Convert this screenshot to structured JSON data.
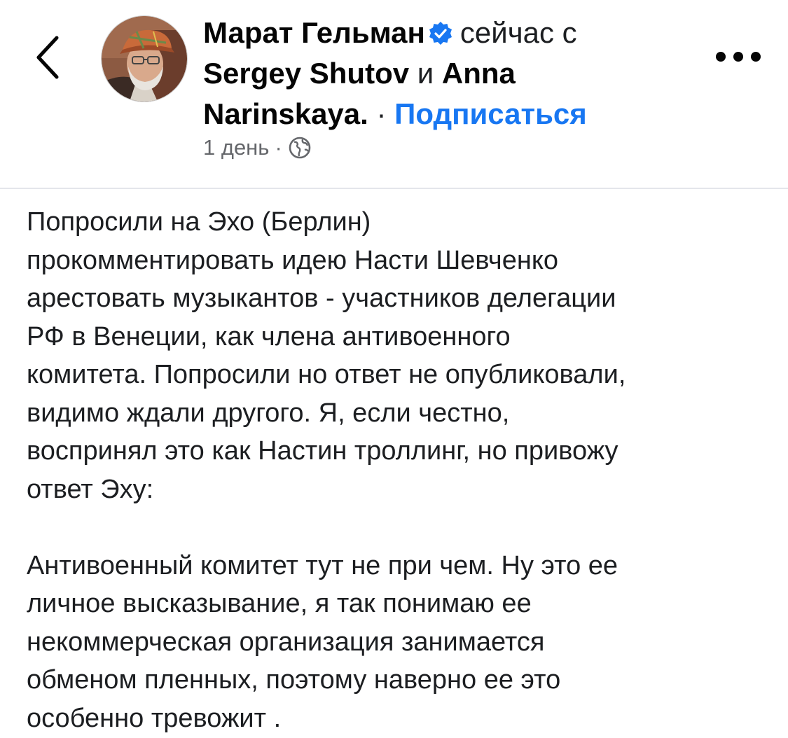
{
  "header": {
    "back_label": "<",
    "author": "Марат Гельман",
    "with_text": "сейчас с",
    "tagged_1": "Sergey Shutov",
    "and_text": "и",
    "tagged_2a": "Anna",
    "tagged_2b": "Narinskaya.",
    "separator": "·",
    "subscribe": "Подписаться",
    "time": "1 день",
    "meta_dot": "·",
    "privacy_icon": "globe-icon",
    "verified_icon": "verified-badge-icon",
    "more_icon": "more-options-icon"
  },
  "colors": {
    "link_blue": "#1877f2",
    "text": "#1c1e21",
    "meta_gray": "#65676b",
    "divider": "#e4e6eb"
  },
  "post": {
    "paragraph1": [
      "Попросили на Эхо (Берлин)",
      "прокомментировать идею Насти Шевченко",
      "арестовать музыкантов - участников делегации",
      "РФ в Венеции, как члена антивоенного",
      "комитета. Попросили но ответ не опубликовали,",
      "видимо ждали другого. Я, если честно,",
      "воспринял это как Настин троллинг, но привожу",
      "ответ Эху:"
    ],
    "paragraph2": [
      "Антивоенный комитет тут не при чем. Ну это ее",
      "личное высказывание, я так понимаю ее",
      "некоммерческая организация занимается",
      "обменом пленных, поэтому наверно ее это",
      "особенно тревожит ."
    ]
  }
}
